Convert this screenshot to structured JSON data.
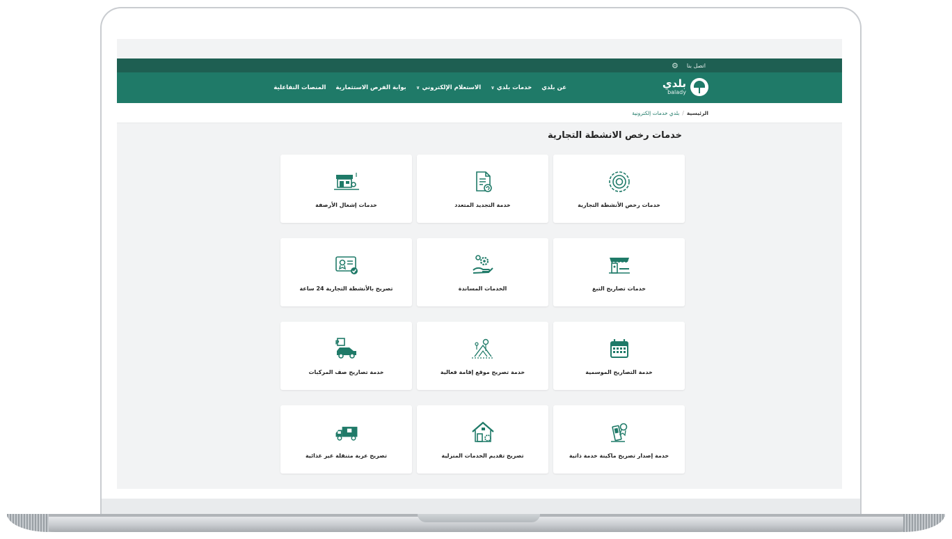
{
  "topbar": {
    "contact": "اتصل بنا",
    "settings_icon": "gear-icon"
  },
  "brand": {
    "name_ar": "بلدي",
    "name_en": "balady",
    "logo_icon": "palm-logo-icon"
  },
  "nav": {
    "items": [
      {
        "label": "عن بلدي",
        "dropdown": false
      },
      {
        "label": "خدمات بلدي",
        "dropdown": true
      },
      {
        "label": "الاستعلام الإلكتروني",
        "dropdown": true
      },
      {
        "label": "بوابة الفرص الاستثمارية",
        "dropdown": false
      },
      {
        "label": "المنصات التفاعلية",
        "dropdown": false
      }
    ]
  },
  "breadcrumb": {
    "home": "الرئيسية",
    "separator": "/",
    "current": "بلدي خدمات إلكترونية"
  },
  "page": {
    "title": "خدمات رخص الانشطة التجارية"
  },
  "cards": [
    {
      "label": "خدمات رخص الأنشطة التجارية",
      "icon": "gear-cycle-icon"
    },
    {
      "label": "خدمة التجديد المتعدد",
      "icon": "document-renew-icon"
    },
    {
      "label": "خدمات إشغال الأرصفة",
      "icon": "storefront-icon"
    },
    {
      "label": "خدمات تصاريح التبغ",
      "icon": "tobacco-shop-icon"
    },
    {
      "label": "الخدمات المساندة",
      "icon": "support-gears-icon"
    },
    {
      "label": "تصريح بالأنشطة التجارية 24 ساعة",
      "icon": "certificate-check-icon"
    },
    {
      "label": "خدمة التصاريح الموسمية",
      "icon": "calendar-icon"
    },
    {
      "label": "خدمة تصريح موقع إقامة فعالية",
      "icon": "event-tent-icon"
    },
    {
      "label": "خدمة تصاريح صف المركبات",
      "icon": "parking-car-icon"
    },
    {
      "label": "خدمة إصدار تصريح ماكينة خدمة ذاتية",
      "icon": "vending-machine-icon"
    },
    {
      "label": "تصريح تقديم الخدمات المنزلية",
      "icon": "home-services-icon"
    },
    {
      "label": "تصريح عربة متنقلة غير غذائية",
      "icon": "mobile-truck-icon"
    }
  ],
  "colors": {
    "primary": "#1f7a68",
    "dark": "#1e5f52",
    "icon": "#1f7a68"
  }
}
